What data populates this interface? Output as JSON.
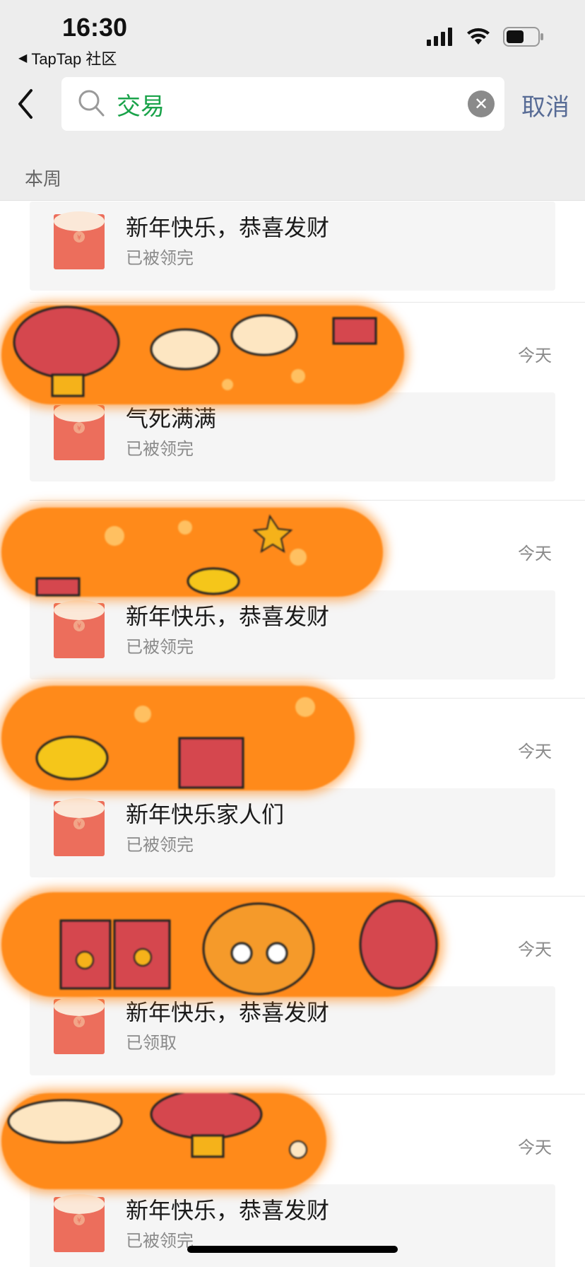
{
  "status_bar": {
    "time": "16:30",
    "back_app": "TapTap 社区"
  },
  "search": {
    "query": "交易",
    "cancel_label": "取消"
  },
  "section_label": "本周",
  "colors": {
    "accent_green": "#1aa34a",
    "link_blue": "#576b95",
    "envelope_red": "#ec6e5c",
    "censor_orange": "#ff8a1a"
  },
  "items": [
    {
      "date": "",
      "title": "新年快乐，恭喜发财",
      "status": "已被领完"
    },
    {
      "date": "今天",
      "title": "气死满满",
      "status": "已被领完"
    },
    {
      "date": "今天",
      "title": "新年快乐，恭喜发财",
      "status": "已被领完"
    },
    {
      "date": "今天",
      "title": "新年快乐家人们",
      "status": "已被领完"
    },
    {
      "date": "今天",
      "title": "新年快乐，恭喜发财",
      "status": "已领取"
    },
    {
      "date": "今天",
      "title": "新年快乐，恭喜发财",
      "status": "已被领完"
    }
  ]
}
